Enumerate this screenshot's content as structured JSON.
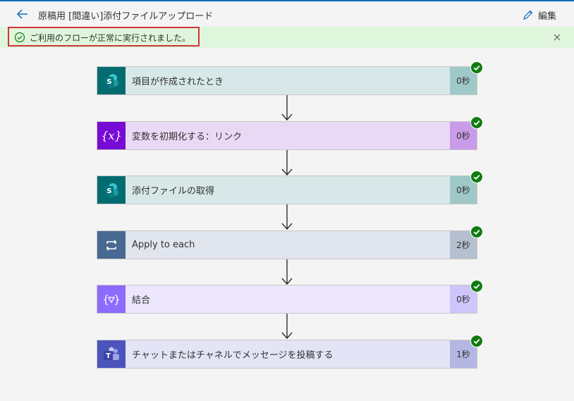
{
  "header": {
    "title": "原稿用 [間違い]添付ファイルアップロード",
    "edit_label": "編集",
    "back_icon": "arrow-left-icon",
    "edit_icon": "pencil-icon"
  },
  "banner": {
    "message": "ご利用のフローが正常に実行されました。",
    "status_icon": "check-circle-icon",
    "close_icon": "close-icon"
  },
  "steps": [
    {
      "label": "項目が作成されたとき",
      "duration": "0秒",
      "icon": "sharepoint-icon",
      "status": "succeeded"
    },
    {
      "label": "変数を初期化する：リンク",
      "duration": "0秒",
      "icon": "variable-icon",
      "status": "succeeded"
    },
    {
      "label": "添付ファイルの取得",
      "duration": "0秒",
      "icon": "sharepoint-icon",
      "status": "succeeded"
    },
    {
      "label": "Apply to each",
      "duration": "2秒",
      "icon": "loop-icon",
      "status": "succeeded"
    },
    {
      "label": "結合",
      "duration": "0秒",
      "icon": "data-operation-icon",
      "status": "succeeded"
    },
    {
      "label": "チャットまたはチャネルでメッセージを投稿する",
      "duration": "1秒",
      "icon": "teams-icon",
      "status": "succeeded"
    }
  ],
  "colors": {
    "accent": "#0f6cbd",
    "success": "#107c10",
    "banner_bg": "#dff6dd",
    "highlight_border": "#d13438",
    "sharepoint": "#036c70",
    "variable": "#770bd6",
    "loop": "#486991",
    "data_operation": "#8c6cff",
    "teams": "#4b53bc"
  }
}
